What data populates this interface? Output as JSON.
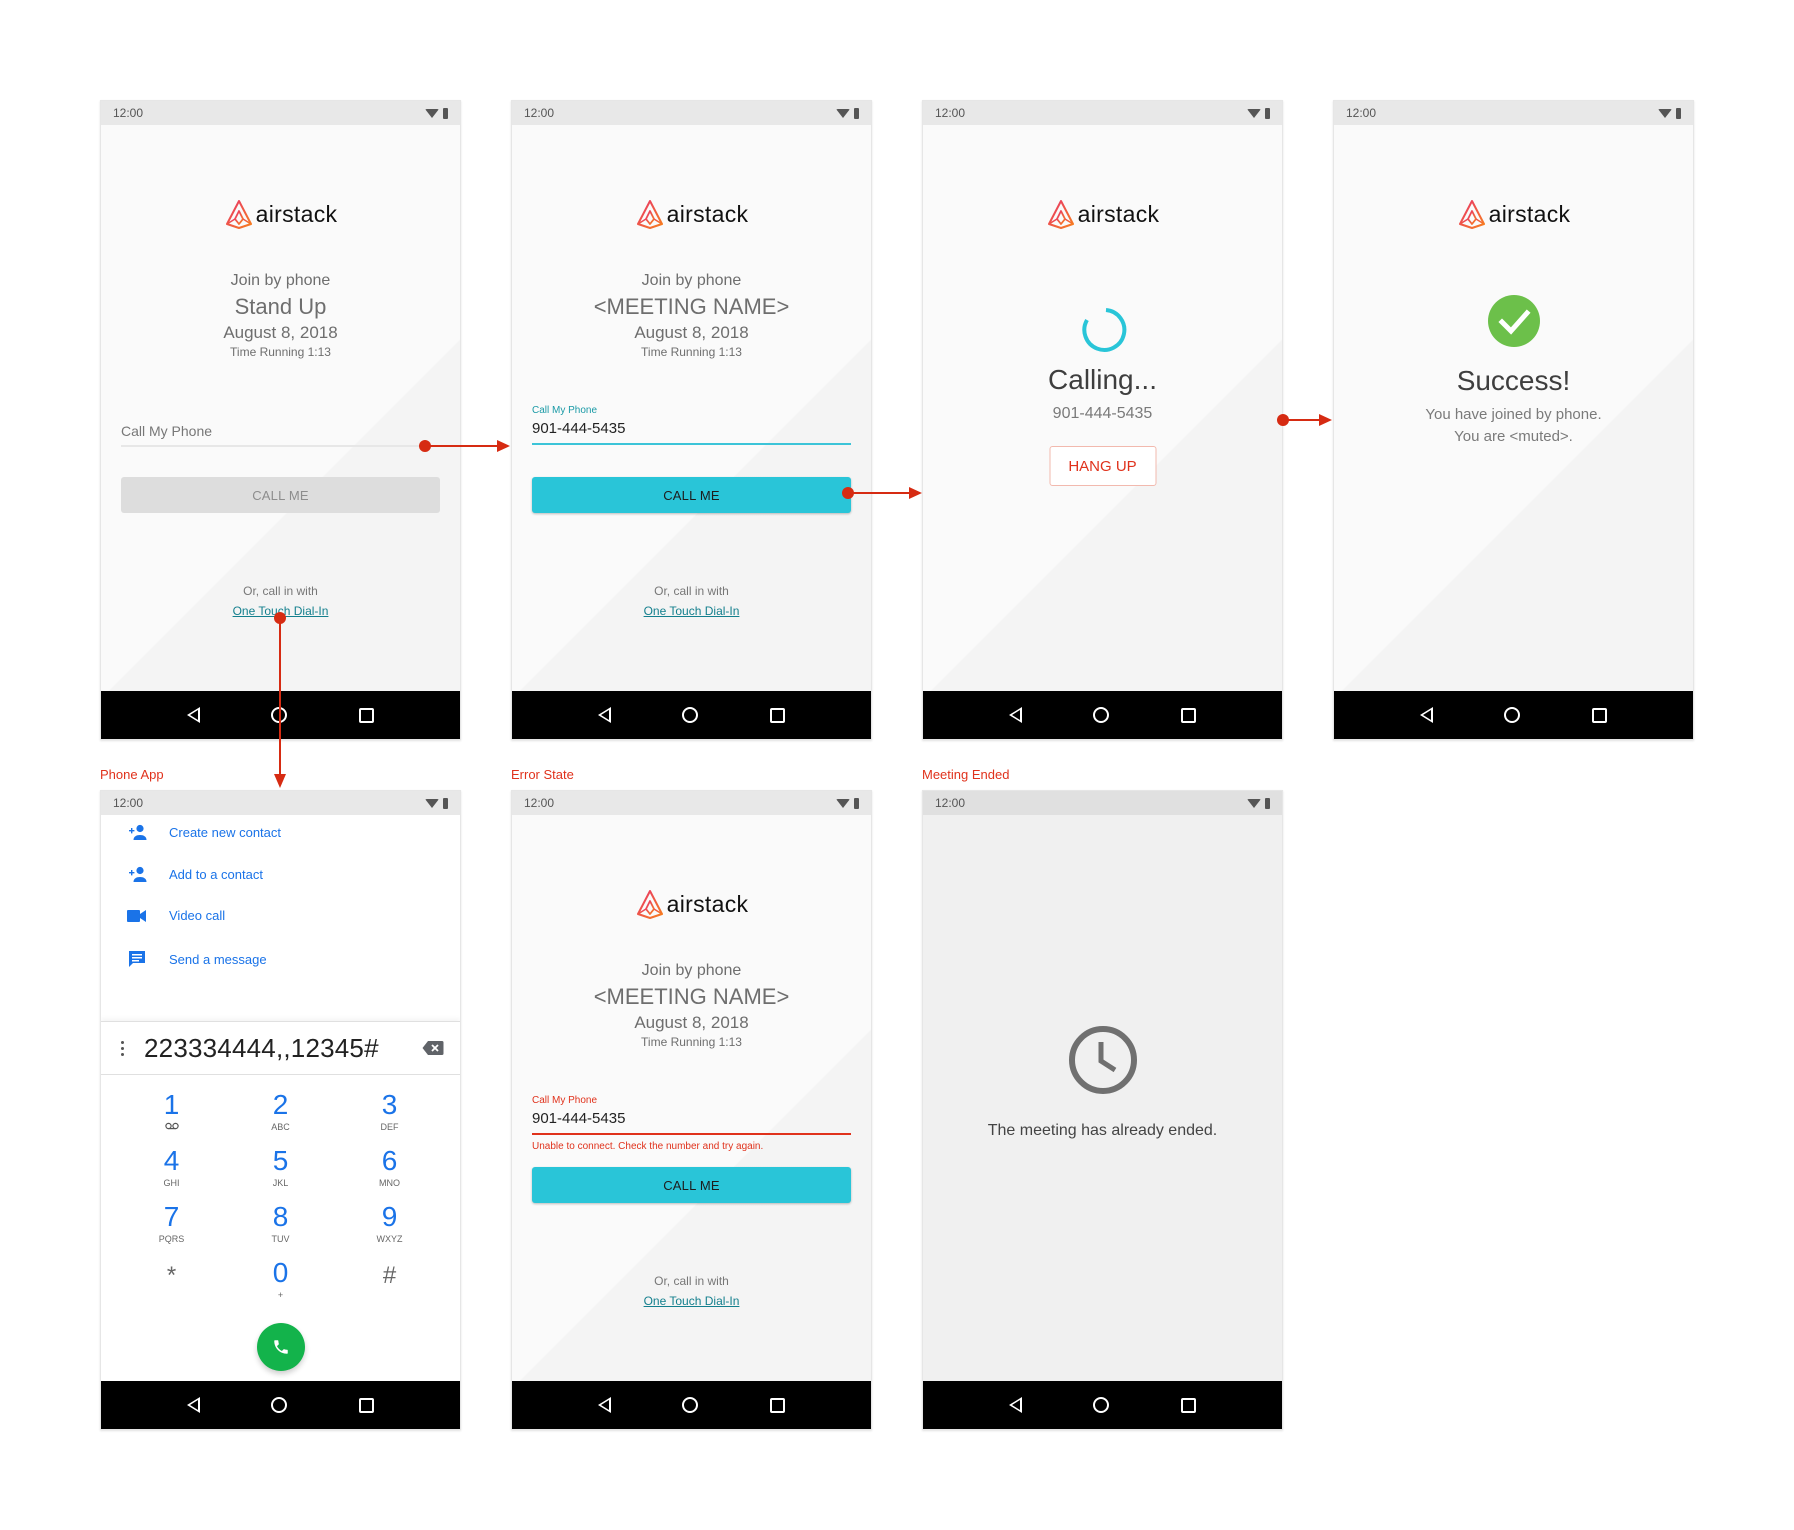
{
  "status_bar": {
    "time": "12:00"
  },
  "brand": {
    "name": "airstack",
    "accent": "#29c5d8",
    "error": "#e0321c",
    "annotation": "#d62b12"
  },
  "screens": {
    "initial": {
      "join_label": "Join by phone",
      "meeting_name": "Stand Up",
      "date": "August 8, 2018",
      "time_running": "Time Running 1:13",
      "phone_placeholder": "Call My Phone",
      "call_button": "CALL ME",
      "or_text": "Or, call in with",
      "dialin_link": "One Touch Dial-In"
    },
    "filled": {
      "join_label": "Join by phone",
      "meeting_name": "<MEETING NAME>",
      "date": "August 8, 2018",
      "time_running": "Time Running 1:13",
      "phone_label": "Call My Phone",
      "phone_value": "901-444-5435",
      "call_button": "CALL ME",
      "or_text": "Or, call in with",
      "dialin_link": "One Touch Dial-In"
    },
    "calling": {
      "title": "Calling...",
      "number": "901-444-5435",
      "hangup_button": "HANG UP"
    },
    "success": {
      "title": "Success!",
      "line1": "You have joined by phone.",
      "line2": "You are <muted>."
    },
    "phone_app": {
      "label": "Phone App",
      "menu": [
        {
          "icon": "person-add-icon",
          "label": "Create new contact"
        },
        {
          "icon": "person-add-icon",
          "label": "Add to a contact"
        },
        {
          "icon": "videocam-icon",
          "label": "Video call"
        },
        {
          "icon": "message-icon",
          "label": "Send a message"
        }
      ],
      "dialed_number": "223334444,,12345#",
      "keys": [
        {
          "digit": "1",
          "sub": "voicemail"
        },
        {
          "digit": "2",
          "sub": "ABC"
        },
        {
          "digit": "3",
          "sub": "DEF"
        },
        {
          "digit": "4",
          "sub": "GHI"
        },
        {
          "digit": "5",
          "sub": "JKL"
        },
        {
          "digit": "6",
          "sub": "MNO"
        },
        {
          "digit": "7",
          "sub": "PQRS"
        },
        {
          "digit": "8",
          "sub": "TUV"
        },
        {
          "digit": "9",
          "sub": "WXYZ"
        },
        {
          "digit": "*",
          "sub": ""
        },
        {
          "digit": "0",
          "sub": "+"
        },
        {
          "digit": "#",
          "sub": ""
        }
      ]
    },
    "error": {
      "label": "Error State",
      "join_label": "Join by phone",
      "meeting_name": "<MEETING NAME>",
      "date": "August 8, 2018",
      "time_running": "Time Running 1:13",
      "phone_label": "Call My Phone",
      "phone_value": "901-444-5435",
      "error_message": "Unable to connect. Check the number and try again.",
      "call_button": "CALL ME",
      "or_text": "Or, call in with",
      "dialin_link": "One Touch Dial-In"
    },
    "ended": {
      "label": "Meeting Ended",
      "message": "The meeting has already ended."
    }
  }
}
